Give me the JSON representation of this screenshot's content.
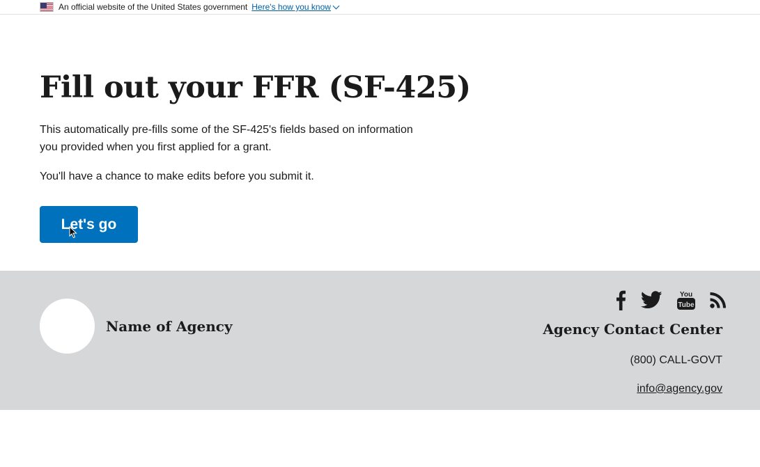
{
  "banner": {
    "official_text": "An official website of the United States government",
    "how_you_know": "Here's how you know"
  },
  "main": {
    "title": "Fill out your FFR (SF-425)",
    "paragraph1": "This automatically pre-fills some of the SF-425's fields based on information you provided when you first applied for a grant.",
    "paragraph2": "You'll have a chance to make edits before you submit it.",
    "button_label": "Let's go"
  },
  "footer": {
    "agency_name": "Name of Agency",
    "social_icons": [
      "facebook-icon",
      "twitter-icon",
      "youtube-icon",
      "rss-icon"
    ],
    "contact_heading": "Agency Contact Center",
    "phone": "(800) CALL-GOVT",
    "email": "info@agency.gov"
  },
  "colors": {
    "primary_button": "#0071bc",
    "footer_bg": "#d6d7d9",
    "link": "#005ea2"
  }
}
